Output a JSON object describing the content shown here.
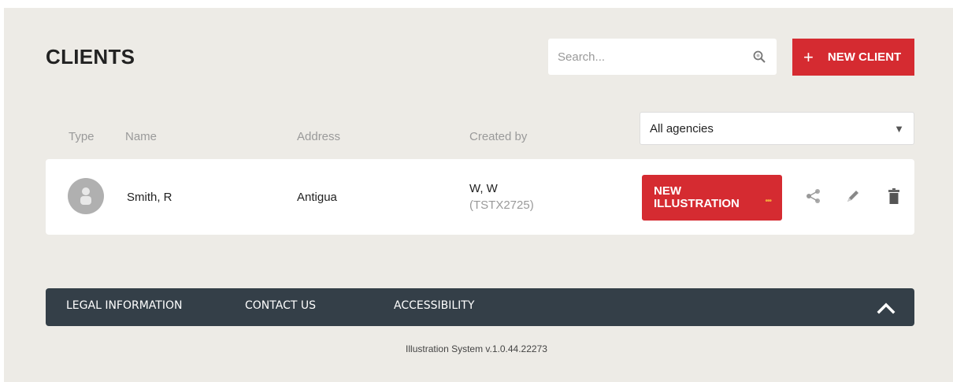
{
  "header": {
    "title": "CLIENTS",
    "search_placeholder": "Search...",
    "new_client_label": "NEW CLIENT"
  },
  "table": {
    "columns": [
      "Type",
      "Name",
      "Address",
      "Created by"
    ],
    "agency_filter": "All agencies",
    "rows": [
      {
        "name": "Smith, R",
        "address": "Antigua",
        "created_by_name": "W, W",
        "created_by_id": "(TSTX2725)",
        "new_illustration_line1": "NEW",
        "new_illustration_line2": "ILLUSTRATION"
      }
    ]
  },
  "footer": {
    "links": [
      "LEGAL INFORMATION",
      "CONTACT US",
      "ACCESSIBILITY"
    ],
    "version": "Illustration System v.1.0.44.22273"
  },
  "colors": {
    "accent": "#d52b31",
    "footer_bg": "#343f48",
    "page_bg": "#edebe6"
  }
}
